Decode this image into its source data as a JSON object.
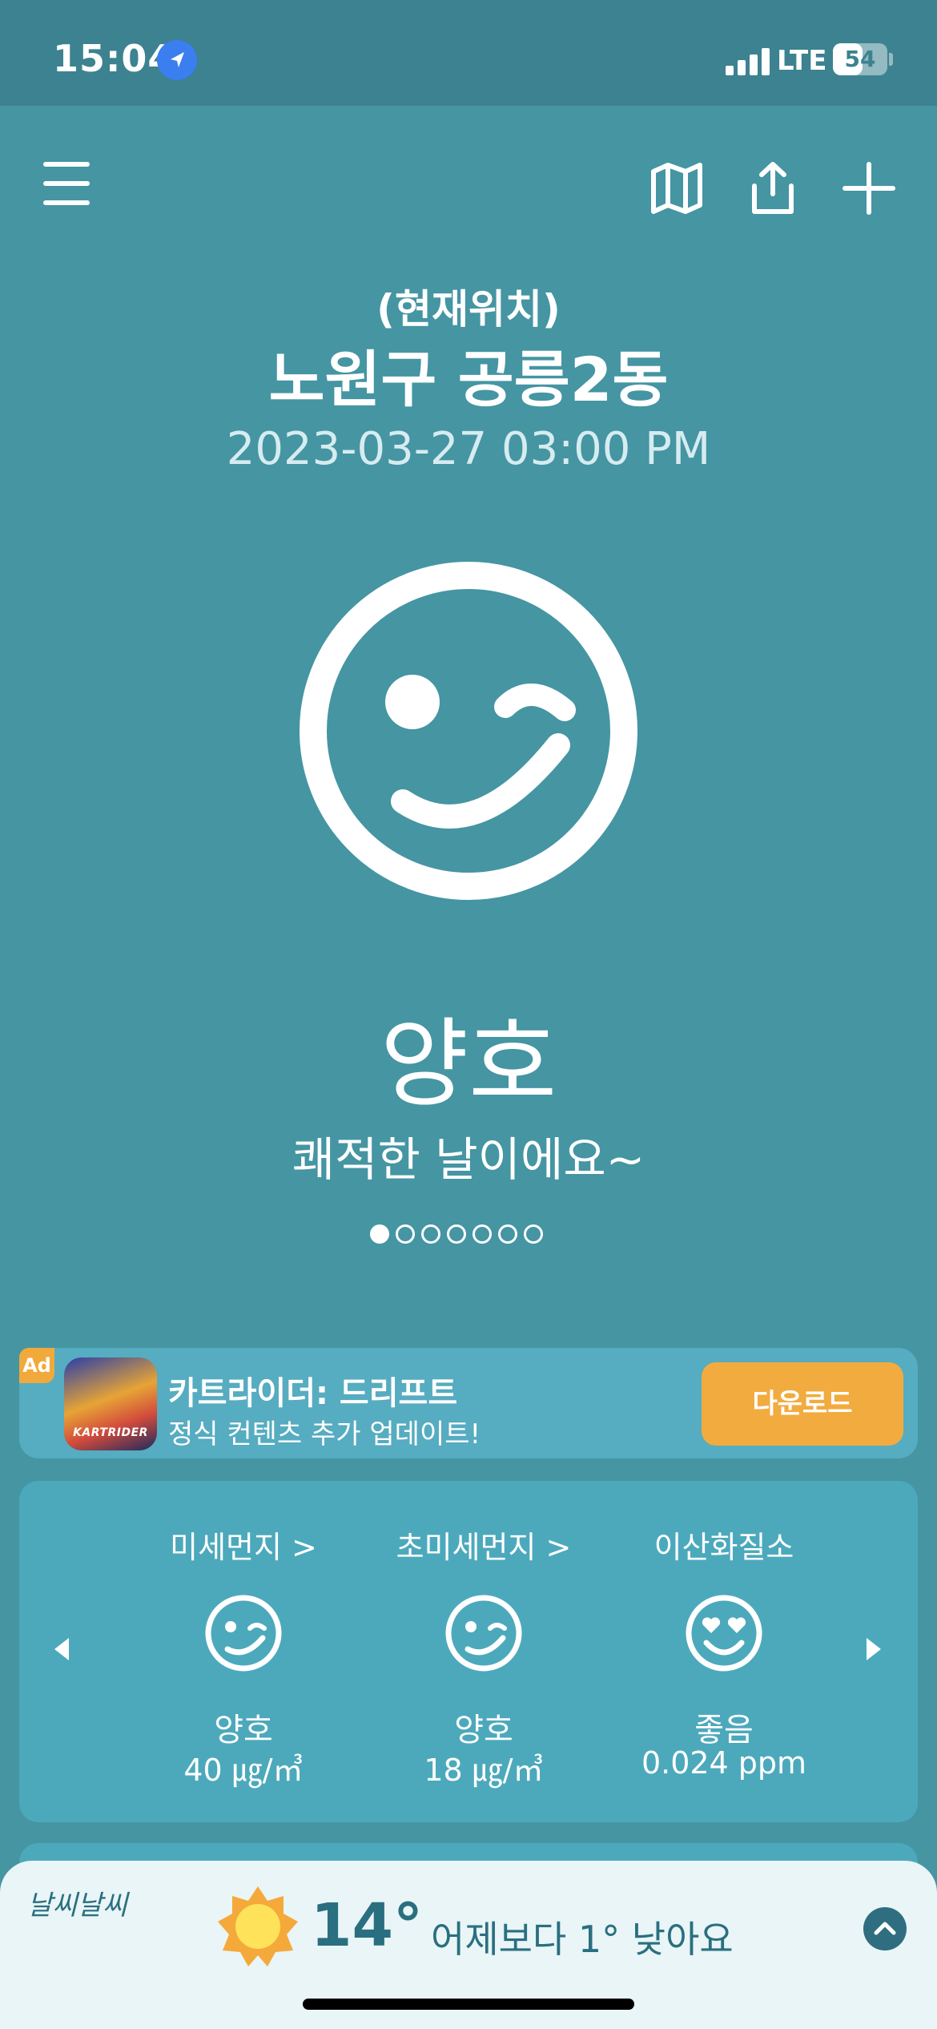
{
  "status_bar": {
    "time": "15:04",
    "network": "LTE",
    "battery": "54",
    "battery_level": 0.54
  },
  "header": {
    "menu_icon": "hamburger-menu-icon",
    "map_icon": "map-icon",
    "share_icon": "share-icon",
    "add_icon": "plus-icon"
  },
  "location": {
    "label": "(현재위치)",
    "name": "노원구 공릉2동",
    "datetime": "2023-03-27 03:00 PM"
  },
  "status": {
    "face_icon": "wink-face-icon",
    "grade": "양호",
    "message": "쾌적한 날이에요~",
    "page_count": 7,
    "active_page": 1
  },
  "ad": {
    "badge": "Ad",
    "title": "카트라이더: 드리프트",
    "subtitle": "정식 컨텐츠 추가 업데이트!",
    "thumb_text": "KARTRIDER",
    "button": "다운로드"
  },
  "air_quality": [
    {
      "label": "미세먼지 >",
      "icon": "wink-face-icon",
      "grade": "양호",
      "value": "40 ㎍/㎥"
    },
    {
      "label": "초미세먼지 >",
      "icon": "wink-face-icon",
      "grade": "양호",
      "value": "18 ㎍/㎥"
    },
    {
      "label": "이산화질소",
      "icon": "heart-eyes-face-icon",
      "grade": "좋음",
      "value": "0.024 ppm"
    }
  ],
  "weather": {
    "brand": "날씨날씨",
    "icon": "sun-icon",
    "temperature": "14°",
    "comparison": "어제보다 1° 낮아요"
  },
  "colors": {
    "background": "#4595a3",
    "status_bar": "#3d8290",
    "card": "#4ca9bc",
    "accent": "#f2ab3e",
    "bottom_bar": "#e9f5f6"
  }
}
